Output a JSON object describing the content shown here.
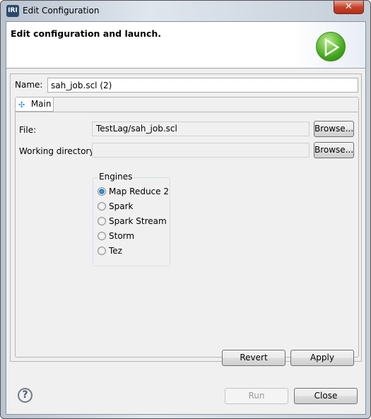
{
  "window": {
    "title": "Edit Configuration",
    "app_icon": "IRI",
    "close_icon": "close-icon"
  },
  "banner": {
    "message": "Edit configuration and launch.",
    "icon": "run-launch-icon"
  },
  "name": {
    "label": "Name:",
    "value": "sah_job.scl (2)"
  },
  "tabs": [
    {
      "label": "Main",
      "icon": "main-tab-icon",
      "selected": true
    }
  ],
  "main": {
    "file": {
      "label": "File:",
      "value": "TestLag/sah_job.scl",
      "browse": "Browse..."
    },
    "workdir": {
      "label": "Working directory:",
      "value": "",
      "browse": "Browse..."
    },
    "engines": {
      "title": "Engines",
      "options": [
        {
          "label": "Map Reduce 2",
          "selected": true
        },
        {
          "label": "Spark",
          "selected": false
        },
        {
          "label": "Spark Stream",
          "selected": false
        },
        {
          "label": "Storm",
          "selected": false
        },
        {
          "label": "Tez",
          "selected": false
        }
      ]
    }
  },
  "buttons": {
    "revert": "Revert",
    "apply": "Apply",
    "run": "Run",
    "close": "Close",
    "help": "?"
  }
}
